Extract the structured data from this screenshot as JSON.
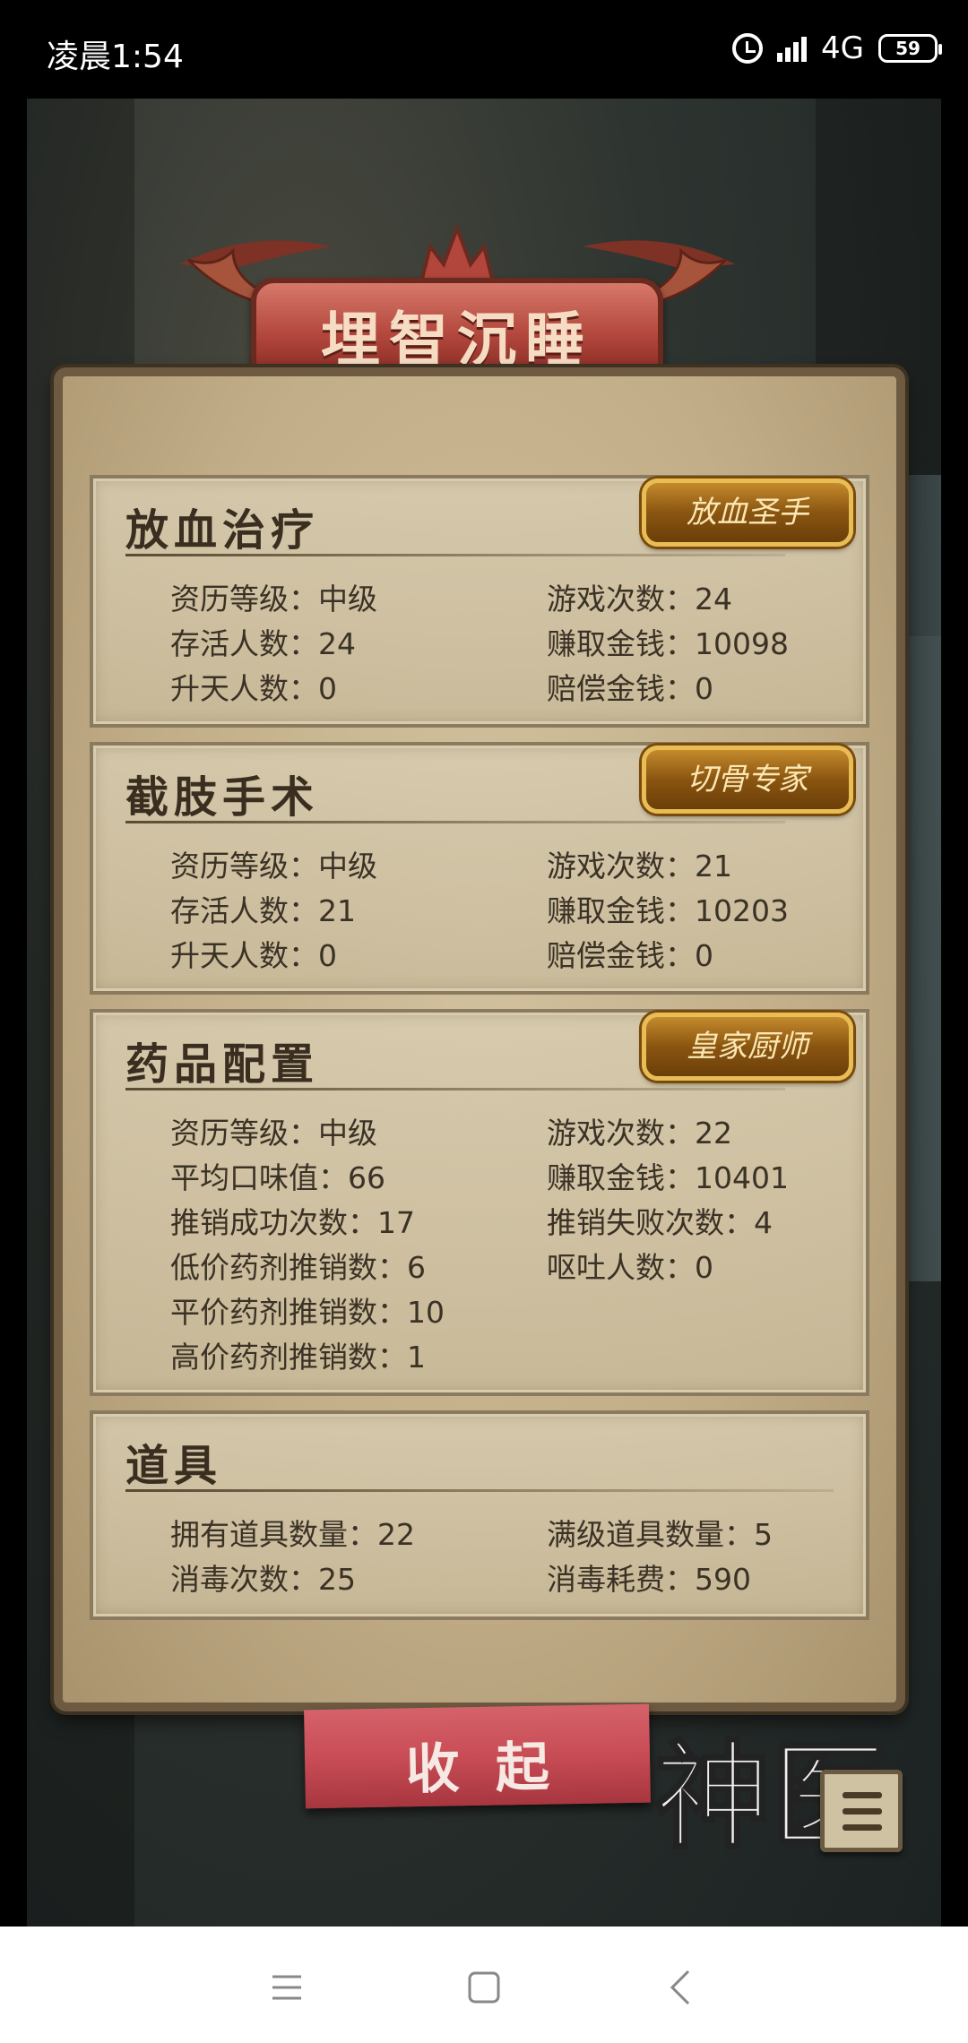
{
  "status_bar": {
    "time": "凌晨1:54",
    "network": "4G",
    "battery": "59"
  },
  "title": "埋智沉睡",
  "sections": [
    {
      "title": "放血治疗",
      "badge": "放血圣手",
      "stats": [
        "资历等级：中级",
        "游戏次数：24",
        "存活人数：24",
        "赚取金钱：10098",
        "升天人数：0",
        "赔偿金钱：0"
      ]
    },
    {
      "title": "截肢手术",
      "badge": "切骨专家",
      "stats": [
        "资历等级：中级",
        "游戏次数：21",
        "存活人数：21",
        "赚取金钱：10203",
        "升天人数：0",
        "赔偿金钱：0"
      ]
    },
    {
      "title": "药品配置",
      "badge": "皇家厨师",
      "stats": [
        "资历等级：中级",
        "游戏次数：22",
        "平均口味值：66",
        "赚取金钱：10401",
        "推销成功次数：17",
        "推销失败次数：4",
        "低价药剂推销数：6",
        "呕吐人数：0",
        "平价药剂推销数：10",
        "",
        "高价药剂推销数：1",
        ""
      ]
    },
    {
      "title": "道具",
      "badge": "",
      "stats": [
        "拥有道具数量：22",
        "满级道具数量：5",
        "消毒次数：25",
        "消毒耗费：590"
      ]
    }
  ],
  "collapse_button": "收起",
  "logo_text": "神医",
  "colors": {
    "accent_red": "#c84c56",
    "parchment": "#c2ae88",
    "badge_gold": "#e8bd55"
  }
}
